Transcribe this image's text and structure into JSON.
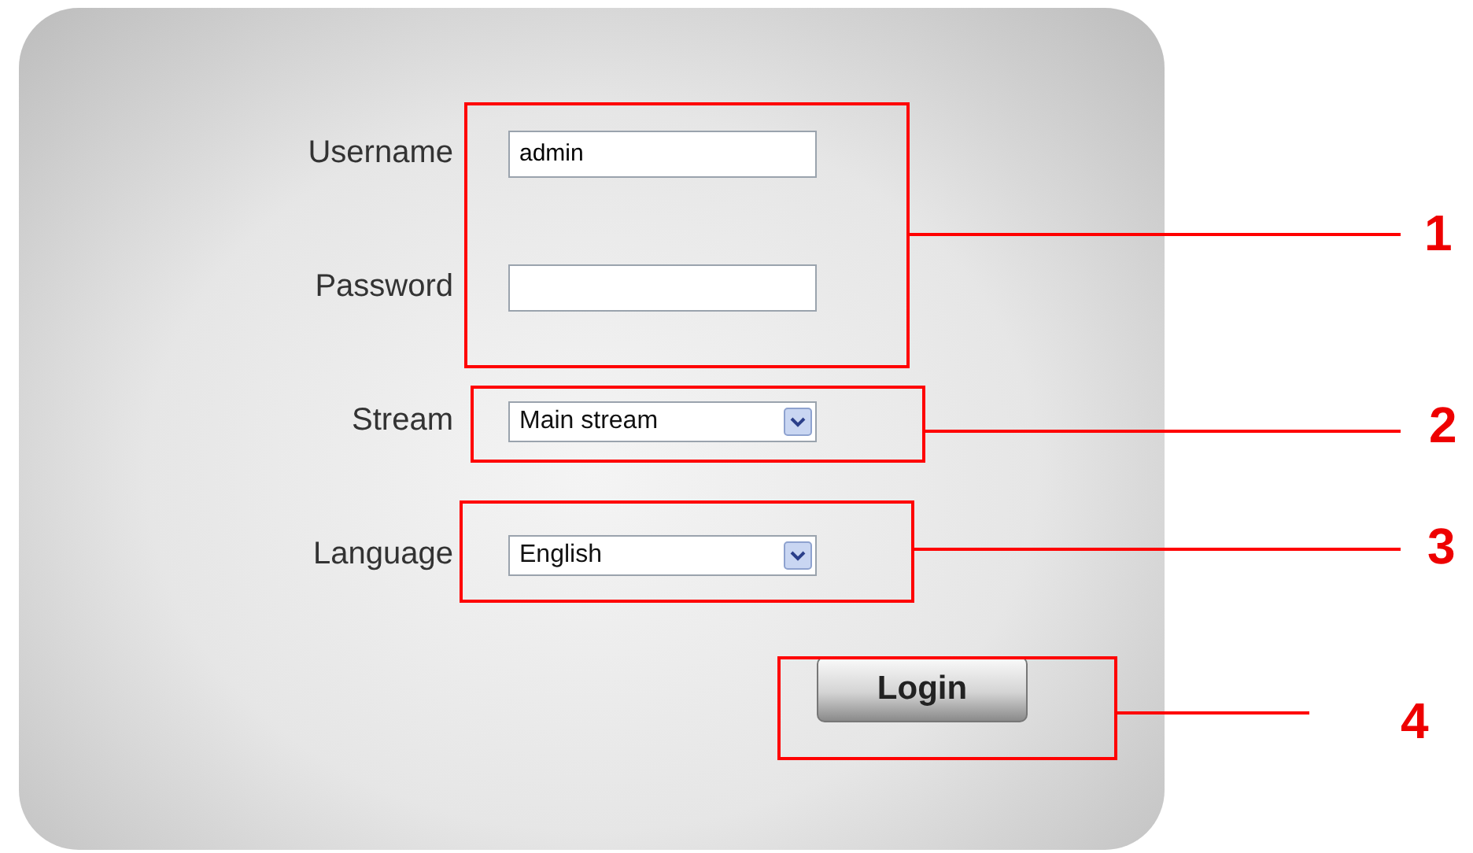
{
  "form": {
    "fields": [
      {
        "kind": "text",
        "label": "Username",
        "value": "admin"
      },
      {
        "kind": "password",
        "label": "Password"
      },
      {
        "kind": "select",
        "label": "Stream",
        "value": "Main stream"
      },
      {
        "kind": "select",
        "label": "Language",
        "value": "English"
      }
    ],
    "button": {
      "label": "Login"
    }
  },
  "callouts": [
    {
      "number": "1"
    },
    {
      "number": "2"
    },
    {
      "number": "3"
    },
    {
      "number": "4"
    }
  ]
}
